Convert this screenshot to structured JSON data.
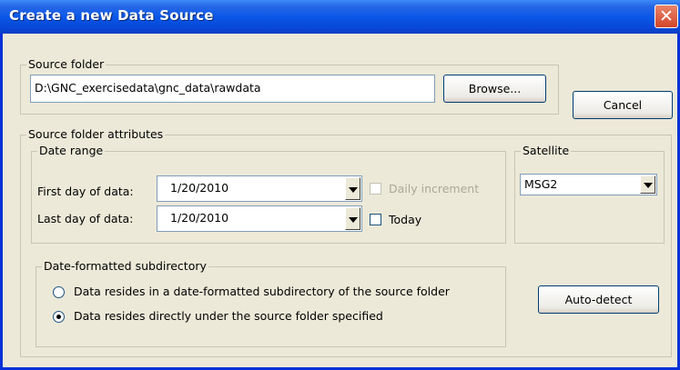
{
  "window": {
    "title": "Create a new Data Source",
    "close_icon": "close-icon"
  },
  "source_folder": {
    "legend": "Source folder",
    "path": "D:\\GNC_exercisedata\\gnc_data\\rawdata",
    "browse_label": "Browse..."
  },
  "cancel_label": "Cancel",
  "attributes": {
    "legend": "Source folder attributes",
    "date_range": {
      "legend": "Date range",
      "first_label": "First day of data:",
      "first_value": "1/20/2010",
      "last_label": "Last day of data:",
      "last_value": "1/20/2010",
      "daily_increment_label": "Daily increment",
      "daily_increment_checked": false,
      "daily_increment_disabled": true,
      "today_label": "Today",
      "today_checked": false
    },
    "satellite": {
      "legend": "Satellite",
      "selected": "MSG2"
    },
    "subdirectory": {
      "legend": "Date-formatted subdirectory",
      "option1": "Data resides in a date-formatted subdirectory of the source folder",
      "option2": "Data resides directly under the source folder specified",
      "selected": 2
    },
    "autodetect_label": "Auto-detect"
  }
}
